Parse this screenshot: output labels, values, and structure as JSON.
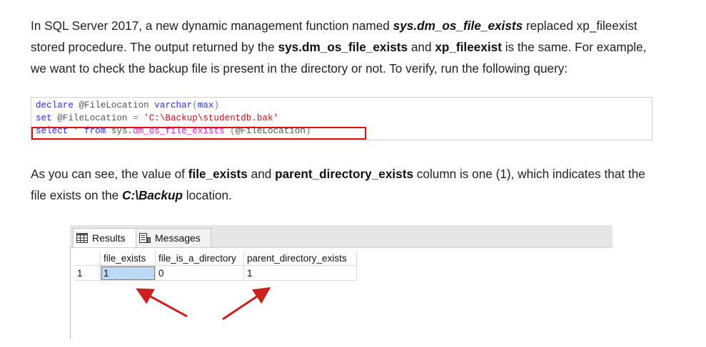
{
  "article": {
    "p1": {
      "s1": "In SQL Server 2017, a new dynamic management function named ",
      "b1": "sys.dm_os_file_exists",
      "s2": " replaced xp_fileexist stored procedure. The output returned by the ",
      "b2": "sys.dm_os_file_exists",
      "s3": " and ",
      "b3": "xp_fileexist",
      "s4": " is the same. For example, we want to check the backup file is present in the directory or not. To verify, run the following query:"
    },
    "p2": {
      "s1": "As you can see, the value of ",
      "b1": "file_exists",
      "s2": " and ",
      "b2": "parent_directory_exists",
      "s3": " column is one (1), which indicates that the file exists on the ",
      "b3": "C:\\Backup",
      "s4": " location."
    }
  },
  "code": {
    "l1": {
      "k1": "declare",
      "v1": " @FileLocation ",
      "k2": "varchar",
      "p1": "(",
      "k3": "max",
      "p2": ")"
    },
    "l2": {
      "k1": "set",
      "v1": " @FileLocation ",
      "op": "=",
      "sp": " ",
      "s1": "'C:\\Backup\\studentdb.bak'"
    },
    "l3": {
      "k1": "select",
      "g1": " * ",
      "k2": "from",
      "v1": " sys.",
      "f1": "dm_os_file_exists",
      "g2": " (",
      "v2": "@FileLocation",
      "g3": ")"
    }
  },
  "results": {
    "tabs": [
      {
        "label": "Results",
        "icon": "grid-icon"
      },
      {
        "label": "Messages",
        "icon": "messages-icon"
      }
    ],
    "columns": [
      "file_exists",
      "file_is_a_directory",
      "parent_directory_exists"
    ],
    "rows": [
      {
        "num": "1",
        "cells": [
          "1",
          "0",
          "1"
        ]
      }
    ]
  },
  "colors": {
    "keyword": "#2a2aff",
    "string": "#d0101a",
    "function": "#e21fd6",
    "highlight_border": "#e01010",
    "arrow": "#cc1f1f",
    "selected_cell": "#bcd9f5"
  }
}
